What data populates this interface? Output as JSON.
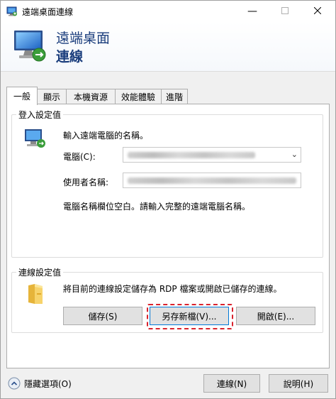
{
  "window": {
    "title": "遠端桌面連線"
  },
  "banner": {
    "title": "遠端桌面",
    "subtitle": "連線"
  },
  "tabs": [
    {
      "label": "一般",
      "active": true
    },
    {
      "label": "顯示",
      "active": false
    },
    {
      "label": "本機資源",
      "active": false
    },
    {
      "label": "效能體驗",
      "active": false
    },
    {
      "label": "進階",
      "active": false
    }
  ],
  "logon": {
    "group_label": "登入設定值",
    "instruction": "輸入遠端電腦的名稱。",
    "computer_label": "電腦(C):",
    "username_label": "使用者名稱:",
    "hint": "電腦名稱欄位空白。請輸入完整的遠端電腦名稱。"
  },
  "connection_settings": {
    "group_label": "連線設定值",
    "description": "將目前的連線設定儲存為 RDP 檔案或開啟已儲存的連線。",
    "save_label": "儲存(S)",
    "save_as_label": "另存新檔(V)...",
    "open_label": "開啟(E)..."
  },
  "footer": {
    "hide_options_label": "隱藏選項(O)",
    "connect_label": "連線(N)",
    "help_label": "說明(H)"
  },
  "colors": {
    "banner_text": "#1a3d7c",
    "highlight_outline": "#d9232e",
    "focus_border": "#0078d7"
  },
  "icons": {
    "title": "remote-desktop-icon",
    "banner": "remote-desktop-large-icon",
    "logon": "computer-icon",
    "connection": "folder-icon",
    "toggle": "chevron-up-icon"
  }
}
